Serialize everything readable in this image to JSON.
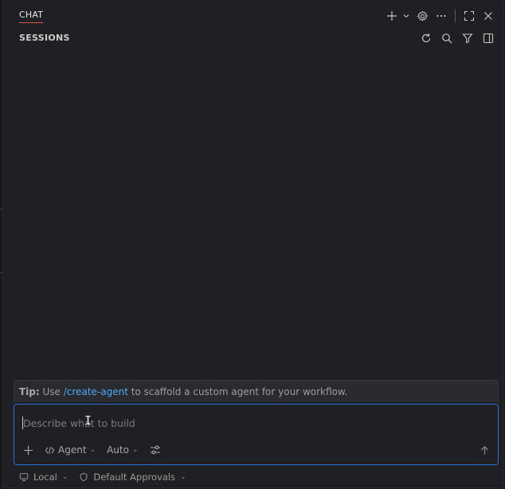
{
  "titlebar": {
    "tab_label": "CHAT",
    "actions": [
      "plus-icon",
      "chevron-down-icon",
      "gear-icon",
      "ellipsis-icon",
      "maximize-icon",
      "close-icon"
    ]
  },
  "sessions": {
    "title": "SESSIONS",
    "actions": [
      "refresh-icon",
      "search-icon",
      "filter-icon",
      "split-panel-icon"
    ]
  },
  "tip": {
    "label": "Tip:",
    "prefix": "Use",
    "command": "/create-agent",
    "suffix": "to scaffold a custom agent for your workflow."
  },
  "composer": {
    "placeholder": "Describe what to build",
    "value": "",
    "mode": "Agent",
    "model": "Auto"
  },
  "status": {
    "location": "Local",
    "approvals": "Default Approvals"
  },
  "colors": {
    "background": "#1f2023",
    "accent_border": "#2f6fd6",
    "link": "#4daafc",
    "tab_underline": "#e0564a"
  }
}
